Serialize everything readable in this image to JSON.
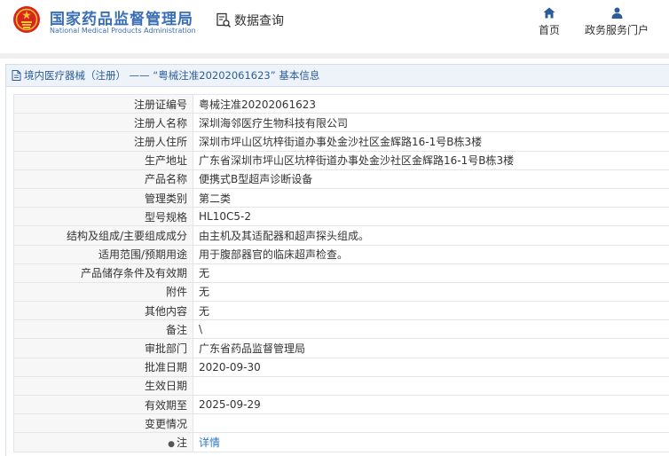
{
  "header": {
    "site_name_cn": "国家药品监督管理局",
    "site_name_en": "National Medical Products Administration",
    "data_query_label": "数据查询",
    "nav": [
      {
        "label": "首页",
        "icon": "home-icon"
      },
      {
        "label": "政务服务门户",
        "icon": "user-icon"
      }
    ]
  },
  "panel": {
    "title": "境内医疗器械（注册） ——  “粤械注准20202061623” 基本信息"
  },
  "records": [
    {
      "label": "注册证编号",
      "value": "粤械注准20202061623"
    },
    {
      "label": "注册人名称",
      "value": "深圳海邻医疗生物科技有限公司"
    },
    {
      "label": "注册人住所",
      "value": "深圳市坪山区坑梓街道办事处金沙社区金辉路16-1号B栋3楼"
    },
    {
      "label": "生产地址",
      "value": "广东省深圳市坪山区坑梓街道办事处金沙社区金辉路16-1号B栋3楼"
    },
    {
      "label": "产品名称",
      "value": "便携式B型超声诊断设备"
    },
    {
      "label": "管理类别",
      "value": "第二类"
    },
    {
      "label": "型号规格",
      "value": "HL10C5-2"
    },
    {
      "label": "结构及组成/主要组成成分",
      "value": "由主机及其适配器和超声探头组成。"
    },
    {
      "label": "适用范围/预期用途",
      "value": "用于腹部器官的临床超声检查。"
    },
    {
      "label": "产品储存条件及有效期",
      "value": "无"
    },
    {
      "label": "附件",
      "value": "无"
    },
    {
      "label": "其他内容",
      "value": "无"
    },
    {
      "label": "备注",
      "value": "\\"
    },
    {
      "label": "审批部门",
      "value": "广东省药品监督管理局"
    },
    {
      "label": "批准日期",
      "value": "2020-09-30"
    },
    {
      "label": "生效日期",
      "value": ""
    },
    {
      "label": "有效期至",
      "value": "2025-09-29"
    },
    {
      "label": "变更情况",
      "value": ""
    }
  ],
  "note_row": {
    "label": "注",
    "link_text": "详情",
    "icon": "lightbulb-icon"
  },
  "colors": {
    "brand_blue": "#3a6fb5",
    "link_blue": "#2f78c4",
    "emblem_red": "#d7261e"
  }
}
